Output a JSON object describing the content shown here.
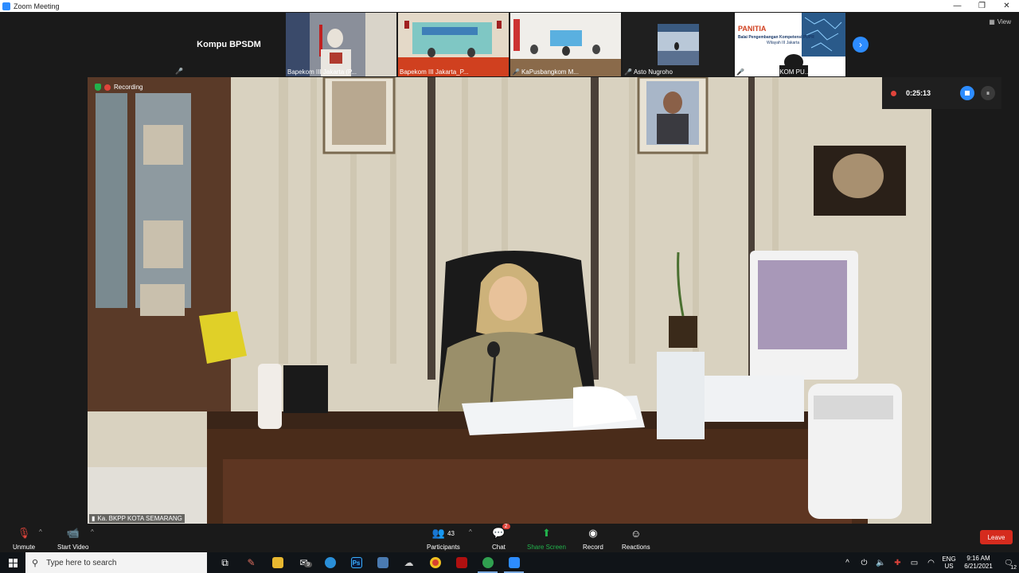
{
  "window": {
    "title": "Zoom Meeting",
    "controls": {
      "minimize": "—",
      "restore": "❐",
      "close": "✕"
    }
  },
  "view_button": {
    "label": "View"
  },
  "gallery": [
    {
      "name": "Kompu BPSDM",
      "type": "text",
      "muted": true
    },
    {
      "name": "Bapekom III Jakarta (P...",
      "type": "video",
      "muted": false
    },
    {
      "name": "Bapekom III Jakarta_P...",
      "type": "video",
      "muted": false
    },
    {
      "name": "KaPusbangkom M...",
      "type": "video",
      "muted": true
    },
    {
      "name": "Asto Nugroho",
      "type": "video",
      "muted": true
    },
    {
      "name": "Mikc_BAPEKOM PU...",
      "type": "slide",
      "muted": true,
      "slide_title": "PANITIA",
      "slide_sub1": "Balai Pengembangan Kompetensi PUPR",
      "slide_sub2": "Wilayah III Jakarta"
    }
  ],
  "main_video": {
    "status": "Recording",
    "speaker": "Ka. BKPP KOTA SEMARANG"
  },
  "recording": {
    "time": "0:25:13"
  },
  "toolbar": {
    "unmute": "Unmute",
    "start_video": "Start Video",
    "participants": "Participants",
    "participants_count": "43",
    "chat": "Chat",
    "chat_badge": "2",
    "share_screen": "Share Screen",
    "record": "Record",
    "reactions": "Reactions",
    "leave": "Leave"
  },
  "taskbar": {
    "search_placeholder": "Type here to search",
    "mail_badge": "9",
    "ps_label": "Ps",
    "language": "ENG",
    "region": "US",
    "time": "9:16 AM",
    "date": "6/21/2021",
    "notifications": "12"
  },
  "colors": {
    "zoom_blue": "#2d8cff",
    "record_red": "#e0443b",
    "leave_red": "#d52b1e",
    "share_green": "#22b24c"
  }
}
